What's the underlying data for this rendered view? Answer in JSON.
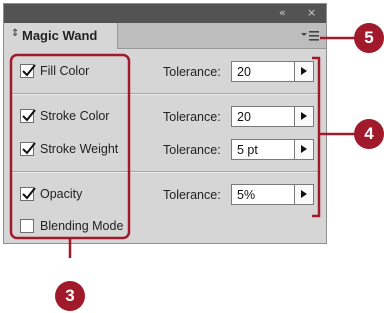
{
  "panel": {
    "title_controls": {
      "collapse": "«",
      "close": "×"
    },
    "tab": {
      "arrows": "⇕",
      "label": "Magic Wand"
    },
    "menu_icon": "panel-menu-icon"
  },
  "rows": [
    {
      "label": "Fill Color",
      "checked": true,
      "tolerance_label": "Tolerance:",
      "tolerance": "20"
    },
    {
      "label": "Stroke Color",
      "checked": true,
      "tolerance_label": "Tolerance:",
      "tolerance": "20"
    },
    {
      "label": "Stroke Weight",
      "checked": true,
      "tolerance_label": "Tolerance:",
      "tolerance": "5 pt"
    },
    {
      "label": "Opacity",
      "checked": true,
      "tolerance_label": "Tolerance:",
      "tolerance": "5%"
    },
    {
      "label": "Blending Mode",
      "checked": false
    }
  ],
  "callouts": {
    "checkboxes": "3",
    "tolerance_fields": "4",
    "panel_menu": "5"
  },
  "colors": {
    "callout": "#a11a2b",
    "panel_bg": "#d6d6d6",
    "titlebar": "#535353"
  }
}
